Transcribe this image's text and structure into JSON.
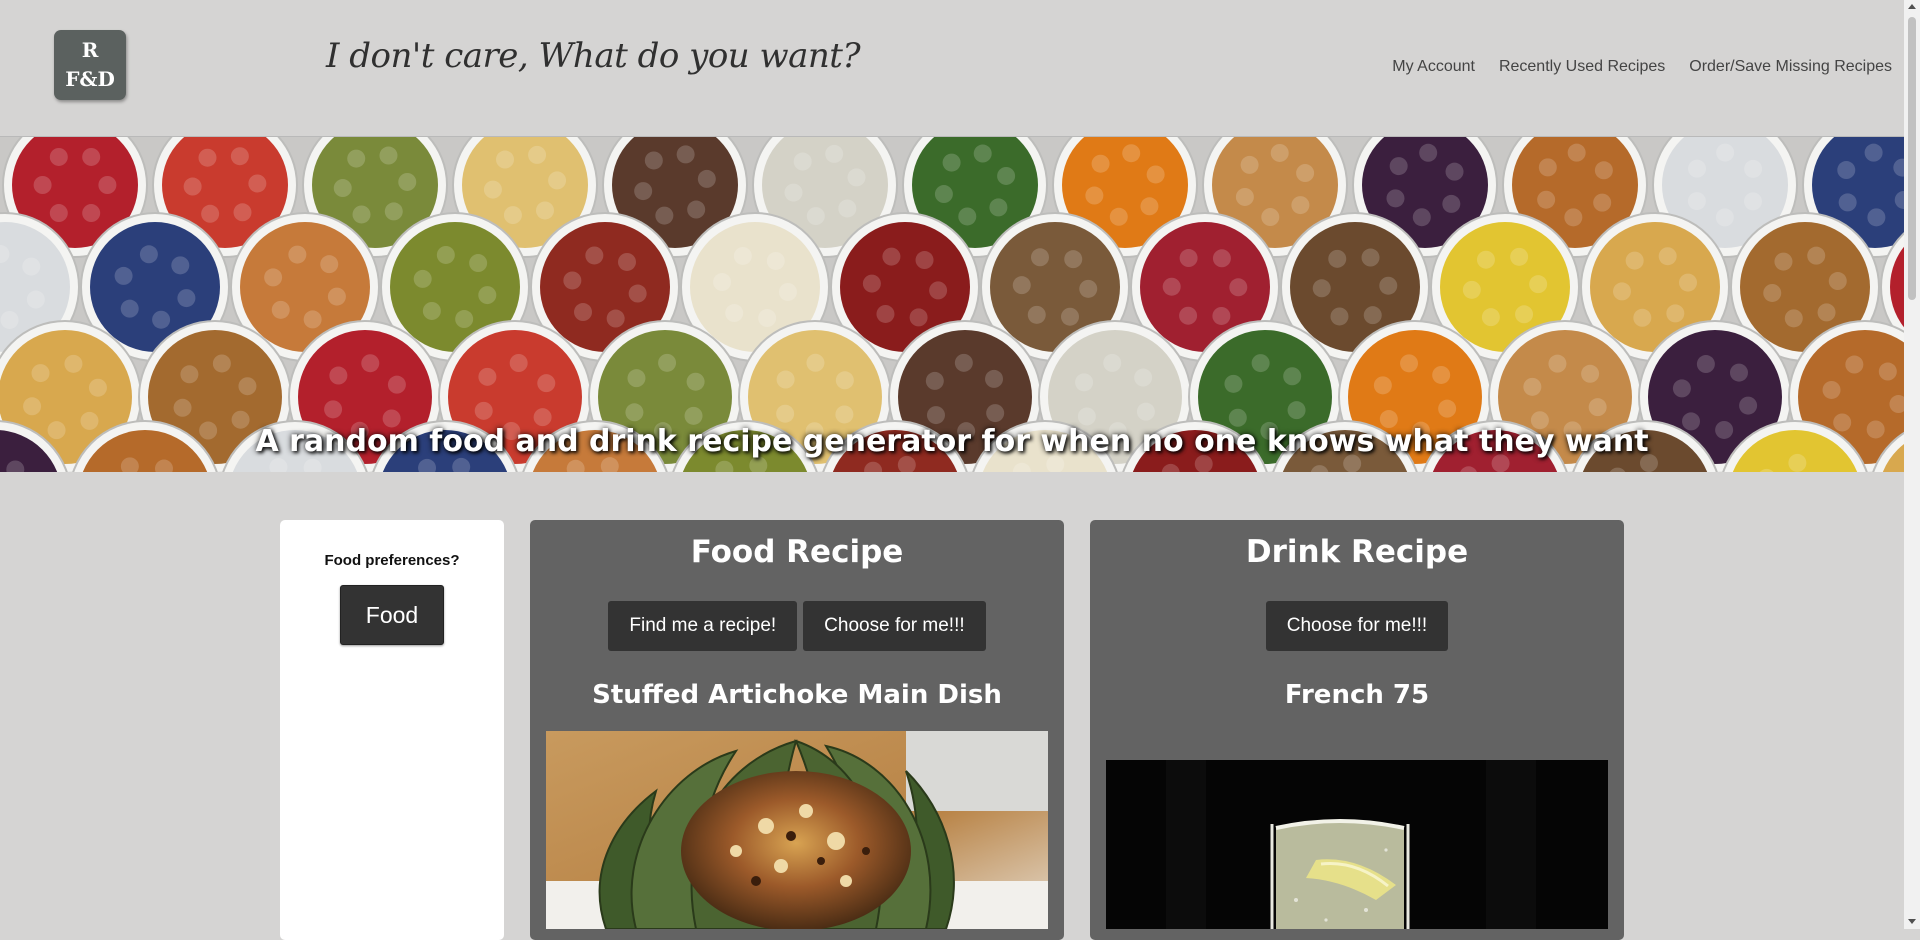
{
  "header": {
    "logo_line1": "R",
    "logo_line2": "F&D",
    "tagline": "I don't care, What do you want?",
    "nav": {
      "my_account": "My Account",
      "recent": "Recently Used Recipes",
      "order": "Order/Save Missing Recipes"
    }
  },
  "hero": {
    "text": "A random food and drink recipe generator for when no one knows what they want"
  },
  "preferences": {
    "label": "Food preferences?",
    "toggle": "Food"
  },
  "food": {
    "title": "Food Recipe",
    "find_button": "Find me a recipe!",
    "choose_button": "Choose for me!!!",
    "dish": "Stuffed Artichoke Main Dish"
  },
  "drink": {
    "title": "Drink Recipe",
    "choose_button": "Choose for me!!!",
    "dish": "French 75"
  },
  "colors": {
    "page_bg": "#d5d4d3",
    "card_bg": "#636363",
    "button_bg": "#333333"
  }
}
